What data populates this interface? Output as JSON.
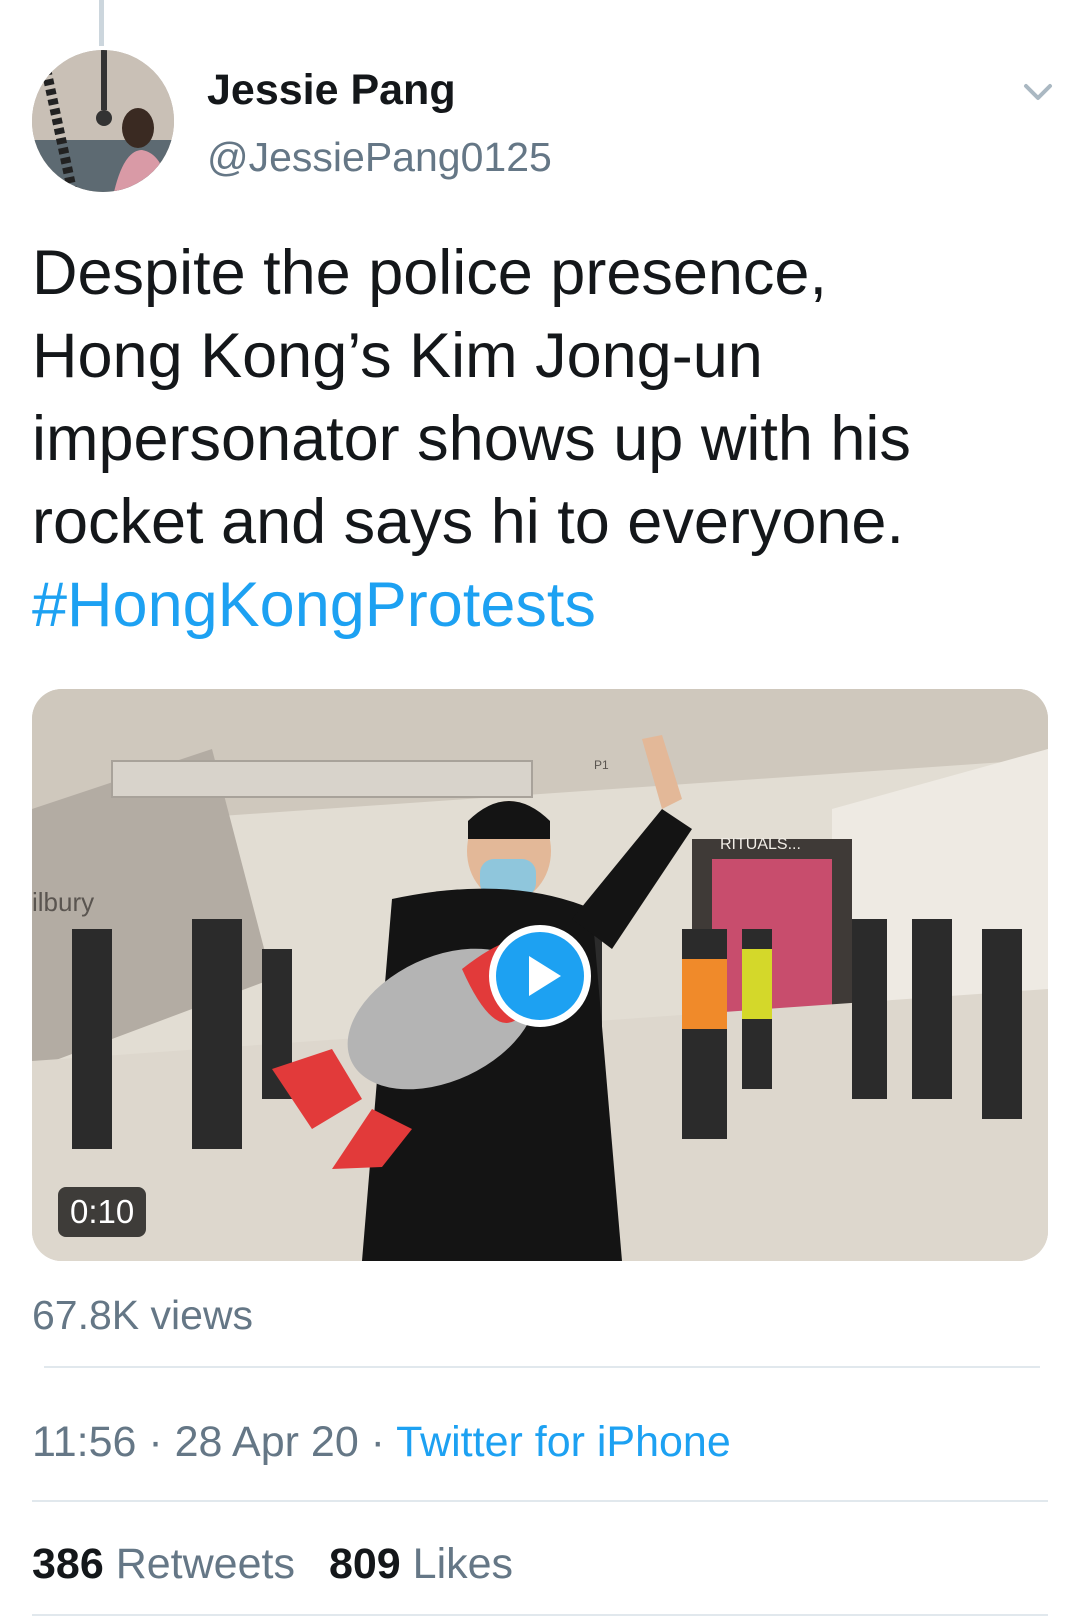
{
  "author": {
    "display_name": "Jessie Pang",
    "handle": "@JessiePang0125",
    "avatar_icon": "profile-photo"
  },
  "tweet": {
    "text_lines": [
      "Despite the police presence,",
      "Hong Kong’s Kim Jong-un",
      "impersonator shows up with his",
      "rocket and says hi to everyone."
    ],
    "hashtag": "#HongKongProtests"
  },
  "media": {
    "type": "video",
    "duration": "0:10",
    "play_icon": "play-icon",
    "scene_signs": {
      "store_left": "ilbury",
      "store_right": "RITUALS...",
      "level": "P1"
    }
  },
  "views": "67.8K views",
  "meta": {
    "time": "11:56",
    "separator": " · ",
    "date": "28 Apr 20",
    "source": "Twitter for iPhone"
  },
  "stats": {
    "retweets_count": "386",
    "retweets_label": "Retweets",
    "likes_count": "809",
    "likes_label": "Likes"
  },
  "colors": {
    "link": "#1da1f2",
    "secondary_text": "#657786",
    "primary_text": "#14171a",
    "divider": "#e1e8ed"
  }
}
